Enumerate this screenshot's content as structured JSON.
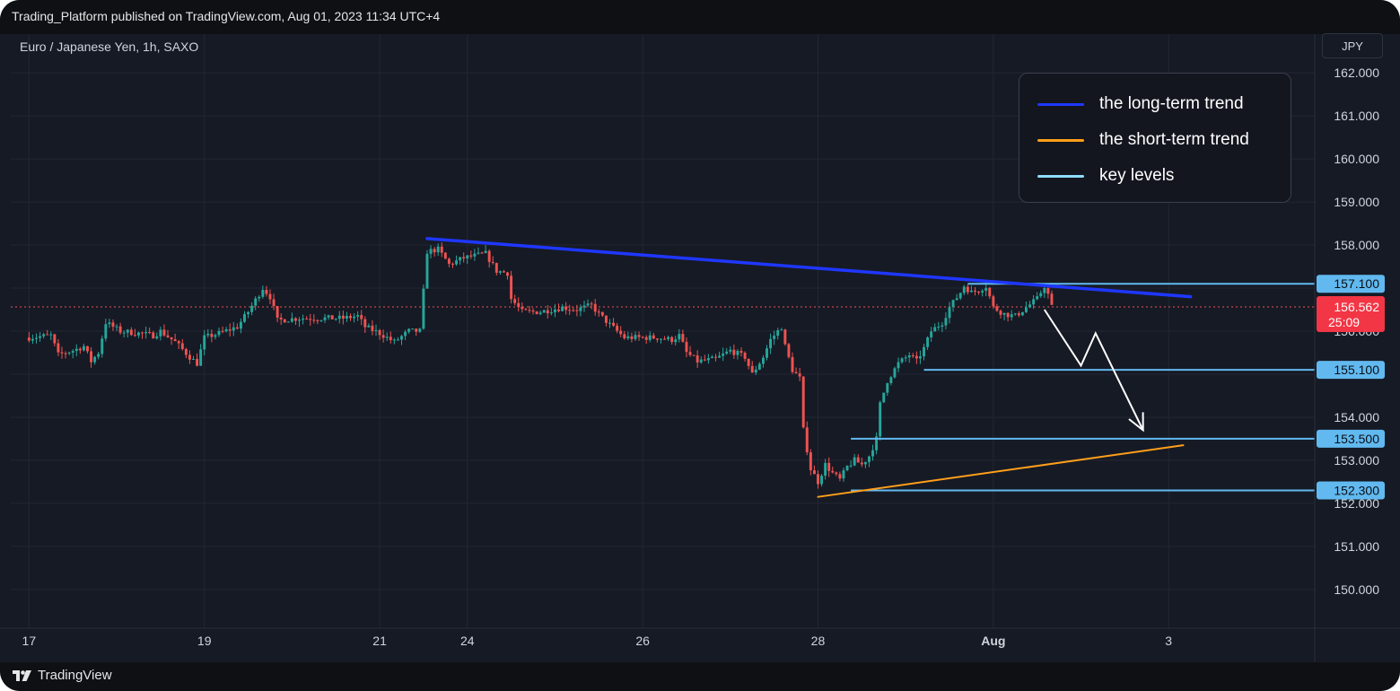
{
  "header": {
    "published": "Trading_Platform published on TradingView.com, Aug 01, 2023 11:34 UTC+4"
  },
  "footer": {
    "brand": "TradingView"
  },
  "currency_button": "JPY",
  "legend": [
    {
      "label": "the long-term trend",
      "color": "#1f37ff"
    },
    {
      "label": "the short-term trend",
      "color": "#ff9f1a"
    },
    {
      "label": "key levels",
      "color": "#8fdcff"
    }
  ],
  "colors": {
    "up": "#26a69a",
    "down": "#ef5350",
    "background": "#161a25",
    "grid": "#232733",
    "key_level": "#61b9ef",
    "price_label": "#f23645"
  },
  "chart_data": {
    "type": "candlestick",
    "symbol": "Euro / Japanese Yen, 1h, SAXO",
    "y_ticks": [
      162,
      161,
      160,
      159,
      158,
      157,
      156,
      155,
      154,
      153,
      152,
      151,
      150
    ],
    "ylim": [
      149.1,
      162.9
    ],
    "x_ticks": [
      {
        "label": "17",
        "x": 0
      },
      {
        "label": "19",
        "x": 48
      },
      {
        "label": "21",
        "x": 96
      },
      {
        "label": "24",
        "x": 120
      },
      {
        "label": "26",
        "x": 168
      },
      {
        "label": "28",
        "x": 216
      },
      {
        "label": "Aug",
        "x": 264
      },
      {
        "label": "3",
        "x": 312
      }
    ],
    "xlim": [
      -5,
      352
    ],
    "current_price": {
      "value": 156.562,
      "label": "156.562",
      "countdown": "25:09"
    },
    "key_levels": [
      {
        "value": 157.1,
        "label": "157.100",
        "x_start": 257
      },
      {
        "value": 155.1,
        "label": "155.100",
        "x_start": 245
      },
      {
        "value": 153.5,
        "label": "153.500",
        "x_start": 225
      },
      {
        "value": 152.3,
        "label": "152.300",
        "x_start": 225
      }
    ],
    "long_term_trend": {
      "from": [
        109,
        158.15
      ],
      "to": [
        318,
        156.8
      ]
    },
    "short_term_trend": {
      "from": [
        216,
        152.15
      ],
      "to": [
        316,
        153.35
      ]
    },
    "forecast_path": [
      [
        278,
        156.5
      ],
      [
        288,
        155.2
      ],
      [
        292,
        155.95
      ],
      [
        305,
        153.7
      ]
    ],
    "price_keyframes": [
      [
        0,
        155.85
      ],
      [
        6,
        155.9
      ],
      [
        8,
        155.45
      ],
      [
        12,
        155.55
      ],
      [
        15,
        155.65
      ],
      [
        17,
        155.3
      ],
      [
        19,
        155.5
      ],
      [
        21,
        156.2
      ],
      [
        25,
        156.0
      ],
      [
        30,
        155.95
      ],
      [
        34,
        155.9
      ],
      [
        36,
        156.0
      ],
      [
        40,
        155.75
      ],
      [
        44,
        155.4
      ],
      [
        46,
        155.25
      ],
      [
        48,
        155.85
      ],
      [
        52,
        155.95
      ],
      [
        57,
        156.1
      ],
      [
        60,
        156.45
      ],
      [
        64,
        157.0
      ],
      [
        66,
        156.8
      ],
      [
        68,
        156.25
      ],
      [
        74,
        156.3
      ],
      [
        80,
        156.3
      ],
      [
        86,
        156.3
      ],
      [
        90,
        156.35
      ],
      [
        92,
        156.1
      ],
      [
        96,
        155.95
      ],
      [
        100,
        155.75
      ],
      [
        104,
        156.0
      ],
      [
        107,
        156.0
      ],
      [
        109,
        157.85
      ],
      [
        112,
        157.9
      ],
      [
        115,
        157.55
      ],
      [
        119,
        157.7
      ],
      [
        122,
        157.75
      ],
      [
        125,
        157.8
      ],
      [
        128,
        157.4
      ],
      [
        131,
        157.35
      ],
      [
        132,
        156.75
      ],
      [
        135,
        156.45
      ],
      [
        140,
        156.45
      ],
      [
        146,
        156.55
      ],
      [
        150,
        156.5
      ],
      [
        154,
        156.6
      ],
      [
        156,
        156.4
      ],
      [
        159,
        156.15
      ],
      [
        163,
        155.85
      ],
      [
        168,
        155.85
      ],
      [
        172,
        155.85
      ],
      [
        176,
        155.8
      ],
      [
        178,
        155.9
      ],
      [
        180,
        155.5
      ],
      [
        183,
        155.3
      ],
      [
        188,
        155.35
      ],
      [
        192,
        155.55
      ],
      [
        196,
        155.4
      ],
      [
        198,
        155.0
      ],
      [
        201,
        155.4
      ],
      [
        203,
        155.8
      ],
      [
        206,
        156.1
      ],
      [
        207,
        155.65
      ],
      [
        209,
        155.1
      ],
      [
        211,
        154.9
      ],
      [
        212,
        153.7
      ],
      [
        214,
        152.8
      ],
      [
        216,
        152.5
      ],
      [
        218,
        152.9
      ],
      [
        220,
        152.7
      ],
      [
        222,
        152.55
      ],
      [
        224,
        152.85
      ],
      [
        226,
        153.0
      ],
      [
        228,
        152.9
      ],
      [
        230,
        153.1
      ],
      [
        232,
        153.5
      ],
      [
        233,
        154.3
      ],
      [
        235,
        154.85
      ],
      [
        238,
        155.25
      ],
      [
        241,
        155.45
      ],
      [
        243,
        155.3
      ],
      [
        245,
        155.6
      ],
      [
        247,
        156.0
      ],
      [
        250,
        156.2
      ],
      [
        252,
        156.55
      ],
      [
        255,
        156.9
      ],
      [
        256,
        157.05
      ],
      [
        258,
        156.9
      ],
      [
        260,
        156.95
      ],
      [
        262,
        157.05
      ],
      [
        264,
        156.55
      ],
      [
        267,
        156.4
      ],
      [
        270,
        156.35
      ],
      [
        273,
        156.55
      ],
      [
        276,
        156.75
      ],
      [
        278,
        157.05
      ],
      [
        279,
        156.85
      ],
      [
        280,
        156.56
      ]
    ]
  }
}
